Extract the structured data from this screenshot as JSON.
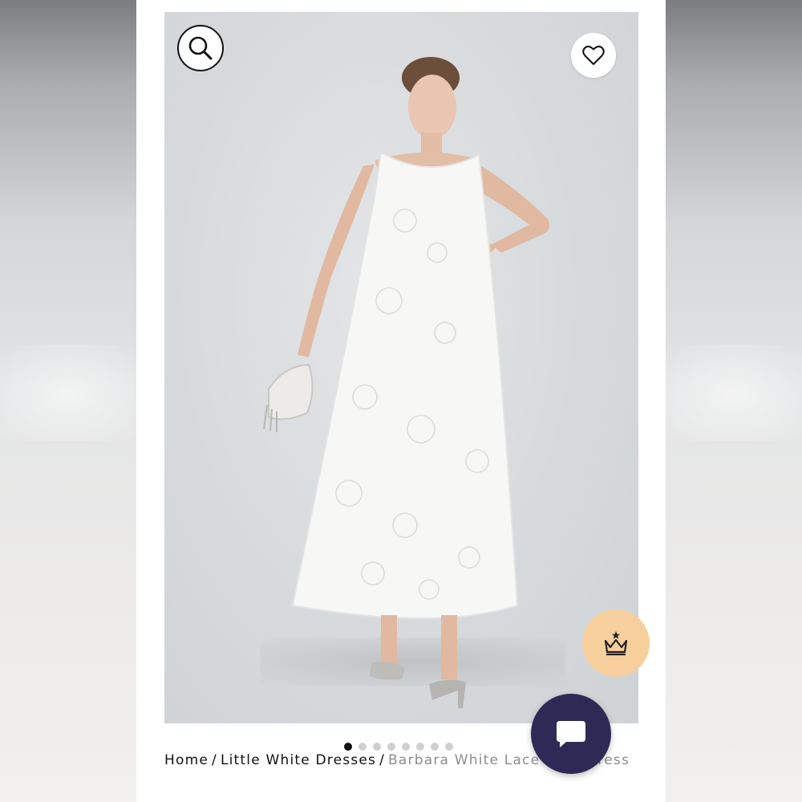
{
  "breadcrumb": {
    "home": "Home",
    "separator": "/",
    "category": "Little White Dresses",
    "current": "Barbara White Lace Maxi Dress"
  },
  "gallery": {
    "total_images": 8,
    "active_index": 0
  },
  "icons": {
    "search": "search-icon",
    "wishlist": "heart-icon",
    "rewards": "crown-icon",
    "chat": "chat-bubble-icon"
  },
  "colors": {
    "rewards_bg": "#f7cf9c",
    "chat_bg": "#2f2a55",
    "breadcrumb_current": "#8d8d8d"
  }
}
